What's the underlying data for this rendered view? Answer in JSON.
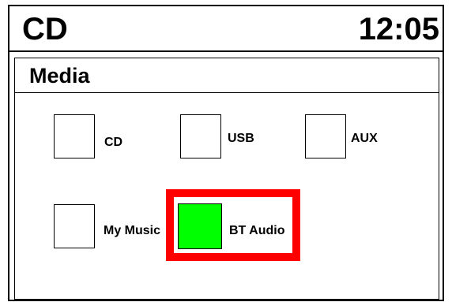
{
  "status_bar": {
    "source": "CD",
    "clock": "12:05"
  },
  "panel": {
    "title": "Media"
  },
  "sources": [
    {
      "label": "CD",
      "selected": false
    },
    {
      "label": "USB",
      "selected": false
    },
    {
      "label": "AUX",
      "selected": false
    },
    {
      "label": "My Music",
      "selected": false
    },
    {
      "label": "BT Audio",
      "selected": true
    }
  ],
  "colors": {
    "selection_border": "#ff0000",
    "selected_fill": "#00ff00"
  }
}
